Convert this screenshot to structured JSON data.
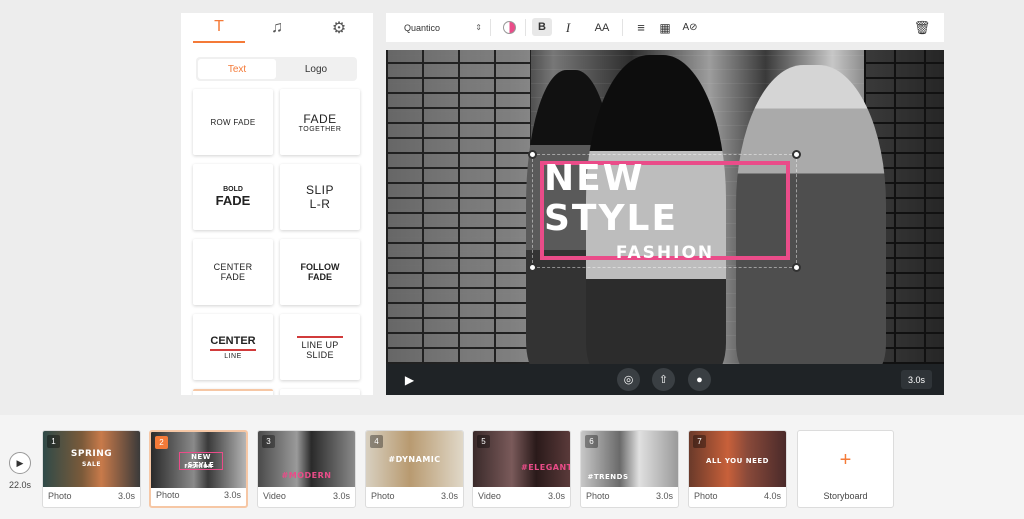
{
  "panel": {
    "tabs": [
      {
        "icon": "text-icon",
        "glyph": "T"
      },
      {
        "icon": "music-icon",
        "glyph": "♫"
      },
      {
        "icon": "gear-icon",
        "glyph": "⚙"
      }
    ],
    "toggle": {
      "text_label": "Text",
      "logo_label": "Logo"
    },
    "presets": [
      {
        "lines": [
          "ROW FADE"
        ]
      },
      {
        "lines": [
          "FADE",
          "TOGETHER"
        ]
      },
      {
        "lines": [
          "BOLD",
          "FADE"
        ]
      },
      {
        "lines": [
          "SLIP",
          "L-R"
        ]
      },
      {
        "lines": [
          "CENTER",
          "FADE"
        ]
      },
      {
        "lines": [
          "FOLLOW",
          "FADE"
        ]
      },
      {
        "lines": [
          "CENTER",
          "LINE"
        ]
      },
      {
        "lines": [
          "LINE UP",
          "SLIDE"
        ]
      }
    ]
  },
  "toolbar": {
    "font": "Quantico",
    "bold_label": "B",
    "italic_label": "I",
    "size_label": "AA",
    "align_glyph": "≡",
    "grid_glyph": "▦",
    "style_label": "A⊘",
    "trash_glyph": "🗑",
    "accent_color": "#ea4c89"
  },
  "canvas": {
    "title": "NEW STYLE",
    "subtitle": "FASHION"
  },
  "player": {
    "duration": "3.0s"
  },
  "timeline": {
    "total": "22.0s",
    "clips": [
      {
        "num": "1",
        "type": "Photo",
        "duration": "3.0s",
        "thumb_text": "SPRING",
        "thumb_sub": "SALE"
      },
      {
        "num": "2",
        "type": "Photo",
        "duration": "3.0s",
        "thumb_text": "NEW STYLE",
        "thumb_sub": "FASHION"
      },
      {
        "num": "3",
        "type": "Video",
        "duration": "3.0s",
        "thumb_text": "#MODERN",
        "thumb_sub": ""
      },
      {
        "num": "4",
        "type": "Photo",
        "duration": "3.0s",
        "thumb_text": "#DYNAMIC",
        "thumb_sub": ""
      },
      {
        "num": "5",
        "type": "Video",
        "duration": "3.0s",
        "thumb_text": "#ELEGANT",
        "thumb_sub": ""
      },
      {
        "num": "6",
        "type": "Photo",
        "duration": "3.0s",
        "thumb_text": "#TRENDS",
        "thumb_sub": ""
      },
      {
        "num": "7",
        "type": "Photo",
        "duration": "4.0s",
        "thumb_text": "ALL YOU NEED",
        "thumb_sub": ""
      }
    ],
    "storyboard_label": "Storyboard",
    "accent_color": "#f47a38"
  }
}
